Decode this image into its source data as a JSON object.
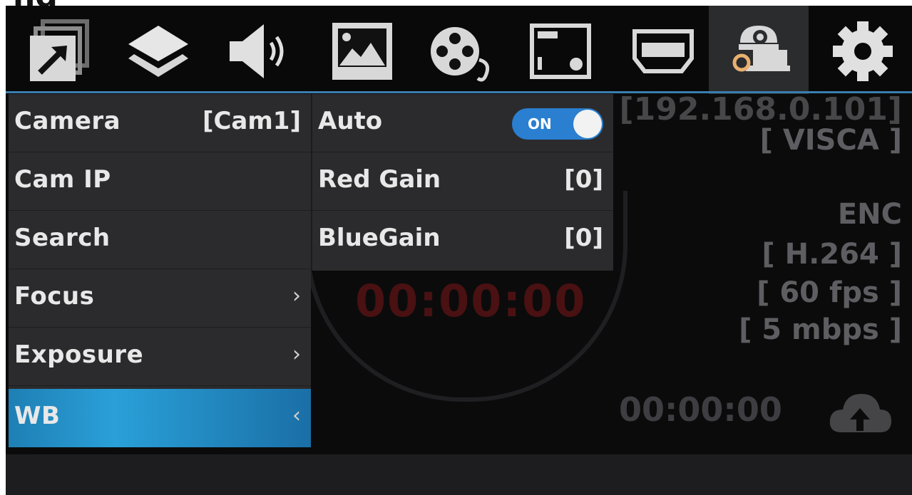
{
  "page_title_fragment": "ng",
  "toolbar": {
    "icons": [
      "export-icon",
      "layers-icon",
      "speaker-icon",
      "image-icon",
      "film-reel-icon",
      "panel-icon",
      "hdmi-icon",
      "camera-settings-icon",
      "gear-icon"
    ],
    "active": "camera-settings-icon"
  },
  "menu_left": {
    "items": [
      {
        "label": "Camera",
        "value": "[Cam1]"
      },
      {
        "label": "Cam IP",
        "value": ""
      },
      {
        "label": "Search",
        "value": ""
      },
      {
        "label": "Focus",
        "chevron": "›"
      },
      {
        "label": "Exposure",
        "chevron": "›"
      },
      {
        "label": "WB",
        "chevron": "‹"
      }
    ],
    "selected_index": 5
  },
  "menu_right": {
    "items": [
      {
        "label": "Auto",
        "toggle": "ON"
      },
      {
        "label": "Red Gain",
        "value": "[0]"
      },
      {
        "label": "BlueGain",
        "value": "[0]"
      }
    ]
  },
  "status": {
    "ip": "[192.168.0.101]",
    "protocol": "[ VISCA ]",
    "enc_label": "ENC",
    "codec": "[ H.264 ]",
    "fps": "[ 60 fps ]",
    "bitrate": "[ 5 mbps ]",
    "record_timer": "00:00:00",
    "stream_timer": "00:00:00"
  },
  "colors": {
    "accent": "#2aa0d8",
    "toggle_on": "#2a7fd0",
    "record_red": "#4a1112"
  }
}
